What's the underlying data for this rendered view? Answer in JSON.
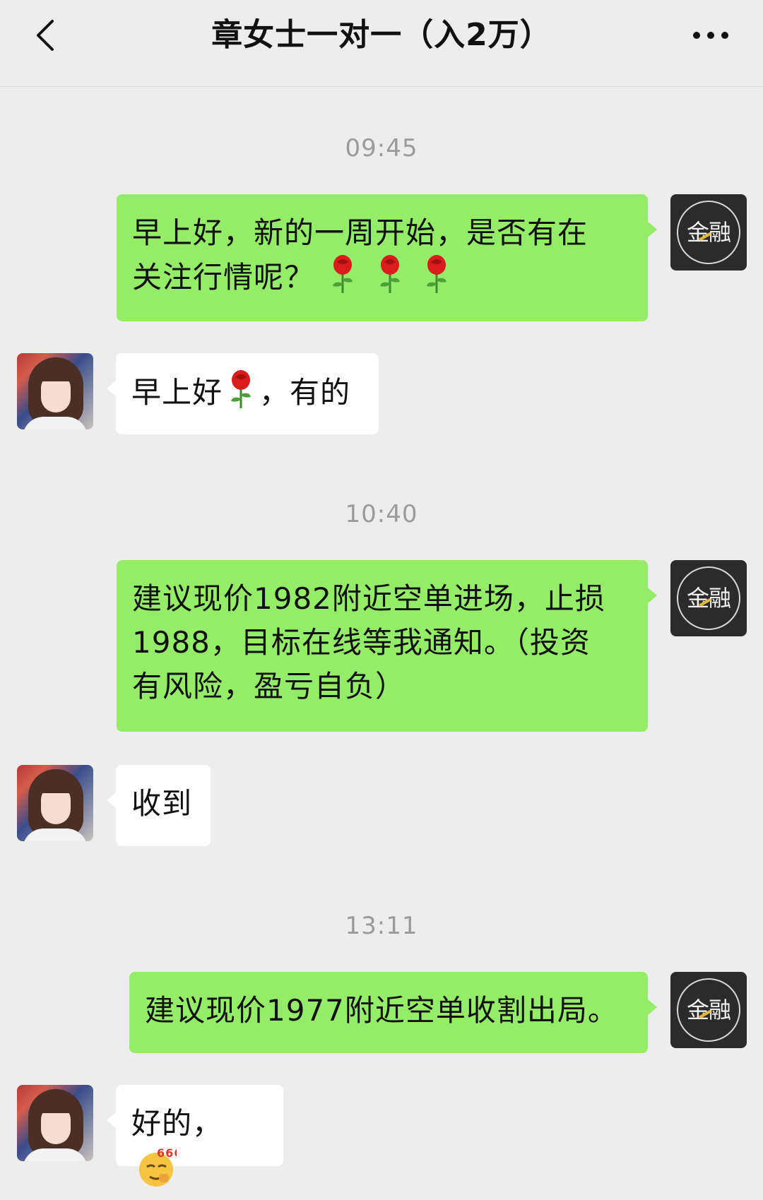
{
  "header": {
    "title": "章女士一对一（入2万）",
    "back_icon": "chevron-left-icon",
    "more_icon": "more-horizontal-icon"
  },
  "avatars": {
    "self_logo_text": "金融",
    "self_logo_icon": "finance-logo-avatar",
    "other_icon": "user-photo-avatar"
  },
  "colors": {
    "background": "#ededed",
    "outgoing_bubble": "#95ec69",
    "incoming_bubble": "#ffffff",
    "timestamp": "#9a9a9a"
  },
  "messages": [
    {
      "type": "timestamp",
      "text": "09:45"
    },
    {
      "type": "outgoing",
      "line1": "早上好，新的一周开始，是否有在",
      "line2": "关注行情呢？",
      "emoji": "rose-emoji x3"
    },
    {
      "type": "incoming",
      "text_before": "早上好",
      "emoji": "rose-emoji",
      "text_after": "，有的"
    },
    {
      "type": "timestamp",
      "text": "10:40"
    },
    {
      "type": "outgoing",
      "line1": "建议现价1982附近空单进场，止损",
      "line2": "1988，目标在线等我通知。（投资",
      "line3": "有风险，盈亏自负）"
    },
    {
      "type": "incoming",
      "text": "收到"
    },
    {
      "type": "timestamp",
      "text": "13:11"
    },
    {
      "type": "outgoing",
      "text": "建议现价1977附近空单收割出局。"
    },
    {
      "type": "incoming",
      "text": "好的，",
      "emoji": "666-emoji"
    }
  ]
}
